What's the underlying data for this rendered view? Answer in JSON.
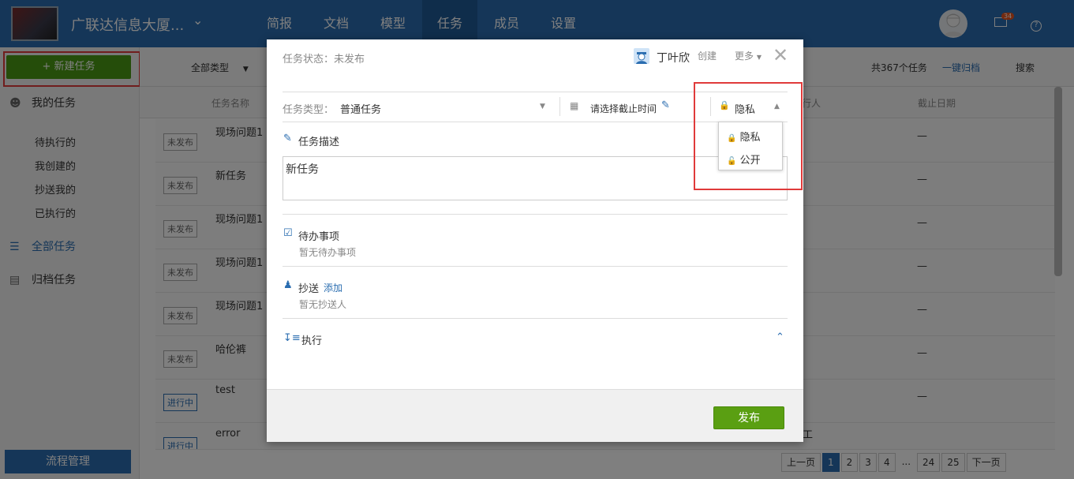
{
  "header": {
    "project_name": "广联达信息大厦...",
    "nav": [
      "简报",
      "文档",
      "模型",
      "任务",
      "成员",
      "设置"
    ],
    "active_nav": "任务",
    "mail_count": "34"
  },
  "sidebar": {
    "new_task": "新建任务",
    "my_tasks": "我的任务",
    "subitems": [
      "待执行的",
      "我创建的",
      "抄送我的",
      "已执行的"
    ],
    "all_tasks": "全部任务",
    "archived": "归档任务",
    "flow": "流程管理"
  },
  "toolbar": {
    "type_filter": "全部类型",
    "total": "共367个任务",
    "archive": "一键归档",
    "search": "搜索"
  },
  "table": {
    "col_name": "任务名称",
    "col_assignee": "行人",
    "col_due": "截止日期",
    "rows": [
      {
        "status": "未发布",
        "name": "现场问题1",
        "due": "—"
      },
      {
        "status": "未发布",
        "name": "新任务",
        "due": "—"
      },
      {
        "status": "未发布",
        "name": "现场问题1",
        "due": "—"
      },
      {
        "status": "未发布",
        "name": "现场问题1",
        "due": "—"
      },
      {
        "status": "未发布",
        "name": "现场问题1",
        "due": "—"
      },
      {
        "status": "未发布",
        "name": "哈伦裤",
        "due": "—"
      },
      {
        "status": "进行中",
        "name": "test",
        "due": "—"
      },
      {
        "status": "进行中",
        "name": "error",
        "due": "工"
      }
    ]
  },
  "pager": {
    "prev": "上一页",
    "pages": [
      "1",
      "2",
      "3",
      "4",
      "...",
      "24",
      "25"
    ],
    "next": "下一页"
  },
  "modal": {
    "status": "任务状态：未发布",
    "creator": "丁叶欣",
    "created": "创建",
    "more": "更多",
    "type_label": "任务类型：",
    "type_value": "普通任务",
    "due_placeholder": "请选择截止时间",
    "privacy": "隐私",
    "privacy_options": [
      "隐私",
      "公开"
    ],
    "desc_label": "任务描述",
    "desc_value": "新任务",
    "todo_label": "待办事项",
    "todo_empty": "暂无待办事项",
    "cc_label": "抄送",
    "cc_add": "添加",
    "cc_empty": "暂无抄送人",
    "exec_label": "执行",
    "publish": "发布"
  }
}
